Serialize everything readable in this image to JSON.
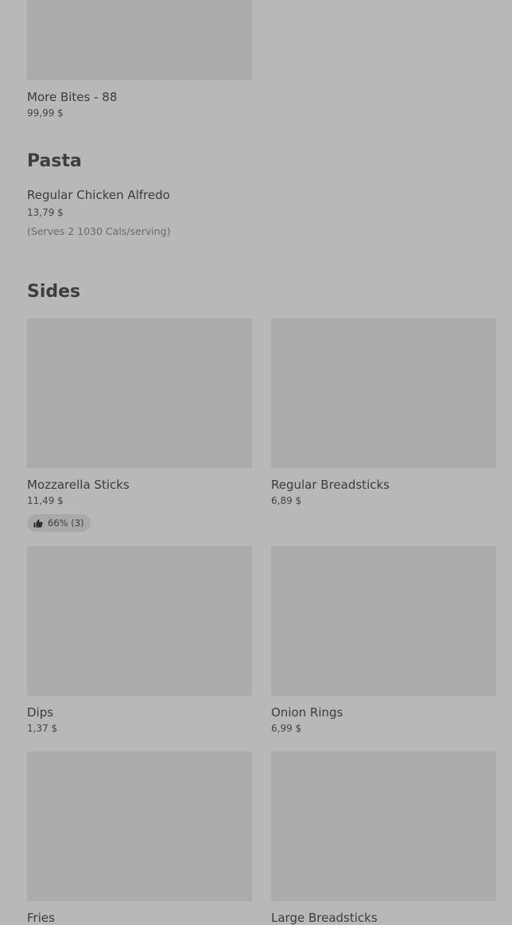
{
  "top_item": {
    "name": "More Bites - 88",
    "price": "99,99 $"
  },
  "pasta": {
    "title": "Pasta",
    "items": [
      {
        "name": "Regular Chicken Alfredo",
        "price": "13,79 $",
        "description": "(Serves 2 1030 Cals/serving)"
      }
    ]
  },
  "sides": {
    "title": "Sides",
    "items": [
      {
        "name": "Mozzarella Sticks",
        "price": "11,49 $",
        "rating": "66% (3)"
      },
      {
        "name": "Regular Breadsticks",
        "price": "6,89 $"
      },
      {
        "name": "Dips",
        "price": "1,37 $"
      },
      {
        "name": "Onion Rings",
        "price": "6,99 $"
      },
      {
        "name": "Fries",
        "price": ""
      },
      {
        "name": "Large Breadsticks",
        "price": ""
      }
    ]
  },
  "icons": {
    "rating_icon": "thumbs-up-icon"
  },
  "colors": {
    "overlay_background": "#b8b8b8",
    "image_placeholder": "#ababab"
  }
}
